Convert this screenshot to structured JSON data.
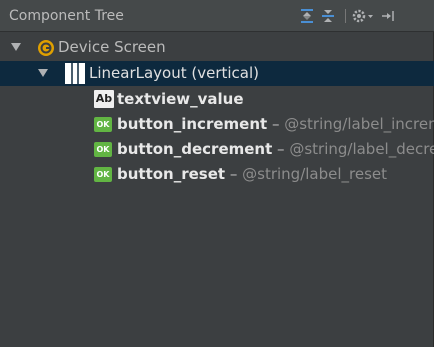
{
  "panel": {
    "title": "Component Tree",
    "toolbar": {
      "expand_all_icon": "expand-all-icon",
      "collapse_all_icon": "collapse-all-icon",
      "gear_icon": "gear-icon",
      "hide_icon": "hide-panel-icon"
    }
  },
  "tree": {
    "root": {
      "label": "Device Screen",
      "icon": "device-screen-icon"
    },
    "layout": {
      "label": "LinearLayout (vertical)",
      "icon": "linear-layout-icon",
      "selected": true
    },
    "children": [
      {
        "icon_text": "Ab",
        "id": "textview_value",
        "dash": "",
        "ref": ""
      },
      {
        "icon_text": "OK",
        "id": "button_increment",
        "dash": " – ",
        "ref": "@string/label_increment"
      },
      {
        "icon_text": "OK",
        "id": "button_decrement",
        "dash": " – ",
        "ref": "@string/label_decrement"
      },
      {
        "icon_text": "OK",
        "id": "button_reset",
        "dash": " – ",
        "ref": "@string/label_reset"
      }
    ]
  },
  "colors": {
    "panel_bg": "#3c3f41",
    "selection_bg": "#0d293e",
    "accent_blue": "#4a8fd4",
    "device_icon": "#e0a000",
    "button_icon": "#62b543"
  }
}
